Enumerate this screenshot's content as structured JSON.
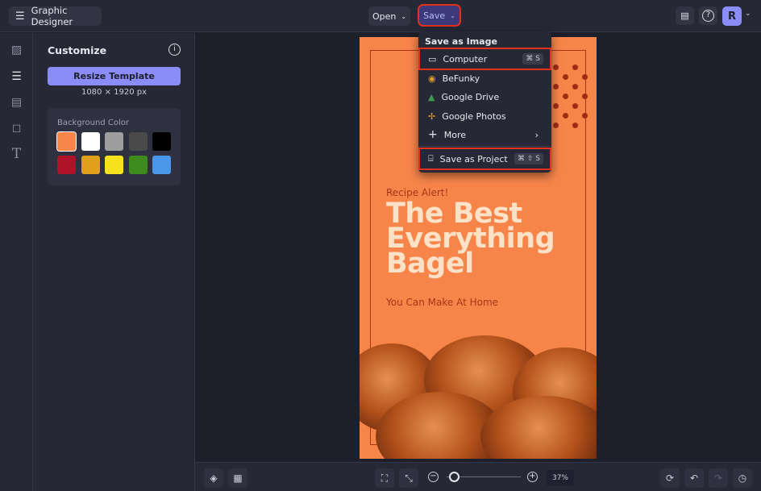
{
  "app": {
    "title": "Graphic Designer",
    "menu_icon": "hamburger-icon"
  },
  "header": {
    "open_label": "Open",
    "save_label": "Save",
    "avatar_initial": "R",
    "accent": "#8a8cf7"
  },
  "rail": {
    "items": [
      "image-icon",
      "sliders-icon",
      "layout-icon",
      "shapes-icon",
      "text-icon"
    ]
  },
  "panel": {
    "title": "Customize",
    "resize_label": "Resize Template",
    "dimensions": "1080 × 1920 px",
    "bg_color_label": "Background Color",
    "colors": [
      "#f7854a",
      "#ffffff",
      "#9e9e9e",
      "#4a4a4a",
      "#000000",
      "#b0122a",
      "#e0a01c",
      "#f5e21c",
      "#3e8a1c",
      "#4a96e8"
    ]
  },
  "save_menu": {
    "heading": "Save as Image",
    "items": [
      {
        "label": "Computer",
        "shortcut": "⌘ S",
        "icon": "monitor-icon"
      },
      {
        "label": "BeFunky",
        "icon": "befunky-icon"
      },
      {
        "label": "Google Drive",
        "icon": "google-drive-icon"
      },
      {
        "label": "Google Photos",
        "icon": "google-photos-icon"
      },
      {
        "label": "More",
        "icon": "plus-icon"
      },
      {
        "label": "Save as Project",
        "shortcut": "⌘ ⇧ S",
        "icon": "briefcase-icon"
      }
    ]
  },
  "poster": {
    "kicker": "Recipe Alert!",
    "title_lines": [
      "The Best",
      "Everything",
      "Bagel"
    ],
    "subtitle": "You Can Make At Home",
    "bg": "#f7854a"
  },
  "bottom": {
    "zoom": "37%",
    "zoom_level": 0.1
  }
}
